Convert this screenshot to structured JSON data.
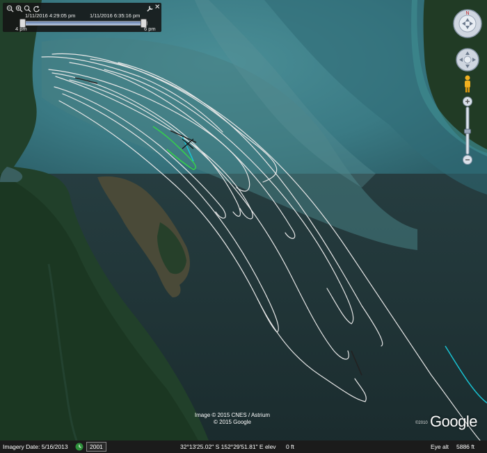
{
  "timebar": {
    "start_time": "1/11/2016    4:29:05 pm",
    "end_time": "1/11/2016    6:35:16 pm",
    "tick_start": "4 pm",
    "tick_end": "6 pm"
  },
  "status_bar": {
    "imagery_date": "Imagery Date: 5/16/2013",
    "history_year": "2001",
    "coordinates": "32°13'25.02\" S  152°29'51.81\" E  elev",
    "elevation": "0 ft",
    "eye_alt_label": "Eye alt",
    "eye_alt_value": "5886 ft"
  },
  "attribution": {
    "line1": "Image © 2015 CNES / Astrium",
    "line2": "© 2015 Google",
    "logo_year": "©2010",
    "logo_text": "Google"
  },
  "colors": {
    "track": "#e8e8e8",
    "track_cyan": "#19c4d4",
    "track_green": "#35d24a",
    "water_shallow": "#3b7f8a",
    "water_deep": "#1f3437",
    "forest": "#1f3d22"
  },
  "icons": {
    "zoom_out": "zoom-out-icon",
    "zoom_in": "zoom-in-icon",
    "settings": "wrench-icon",
    "compass": "compass-ring-icon",
    "pegman": "street-view-icon"
  }
}
